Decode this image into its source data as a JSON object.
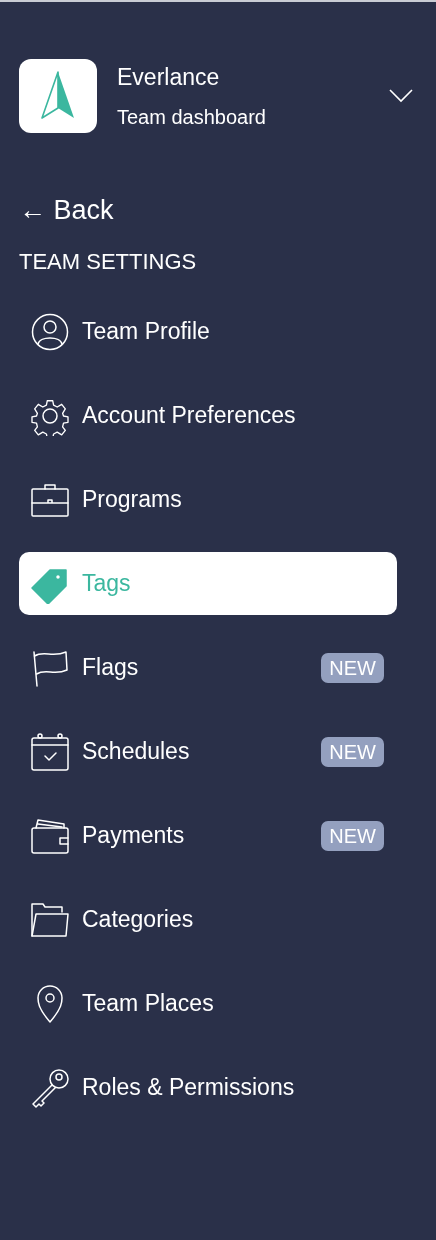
{
  "team": {
    "name": "Everlance",
    "subtitle": "Team dashboard"
  },
  "back": "← Back",
  "section_title": "TEAM SETTINGS",
  "items": [
    {
      "label": "Team Profile",
      "selected": false
    },
    {
      "label": "Account Preferences",
      "selected": false
    },
    {
      "label": "Programs",
      "selected": false
    },
    {
      "label": "Tags",
      "selected": true
    },
    {
      "label": "Flags",
      "selected": false,
      "badge": "NEW"
    },
    {
      "label": "Schedules",
      "selected": false,
      "badge": "NEW"
    },
    {
      "label": "Payments",
      "selected": false,
      "badge": "NEW"
    },
    {
      "label": "Categories",
      "selected": false
    },
    {
      "label": "Team Places",
      "selected": false
    },
    {
      "label": "Roles & Permissions",
      "selected": false
    }
  ]
}
